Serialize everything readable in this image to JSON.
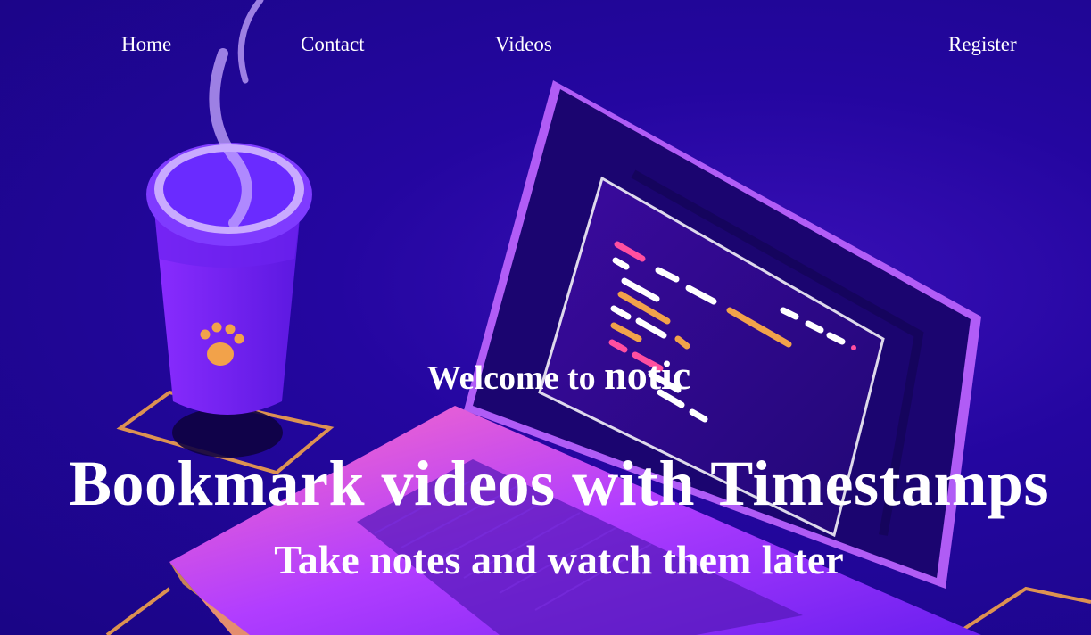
{
  "nav": {
    "home": "Home",
    "contact": "Contact",
    "videos": "Videos",
    "register": "Register"
  },
  "hero": {
    "welcome_prefix": "Welcome to ",
    "brand": "notic",
    "headline": "Bookmark videos with Timestamps",
    "subline": "Take notes and watch them later"
  },
  "colors": {
    "background": "#1f0793",
    "text": "#ffffff",
    "accent_purple": "#a73bff",
    "accent_orange": "#f2a24a"
  }
}
